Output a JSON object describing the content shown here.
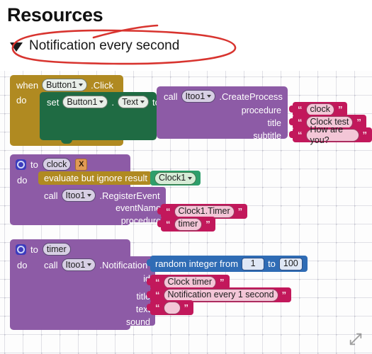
{
  "header": {
    "title": "Resources",
    "collapse_label": "Notification every second",
    "triangle_icon": "triangle-down-icon",
    "annotation_color": "#d32f2f",
    "annotation_shape": "hand-drawn-red-ellipse"
  },
  "canvas": {
    "expand_icon": "expand-diagonal-arrows-icon",
    "background": "dotted-grid"
  },
  "blocks": {
    "event_block": {
      "color": "#b08a21",
      "when_label": "when",
      "component": "Button1",
      "event": ".Click",
      "do_label": "do",
      "setter": {
        "color": "#1f6b43",
        "set_label": "set",
        "component": "Button1",
        "dot": ".",
        "property": "Text",
        "to_label": "to"
      },
      "call": {
        "color": "#8d5ba6",
        "call_label": "call",
        "component": "Itoo1",
        "method": ".CreateProcess",
        "params": [
          {
            "name": "procedure",
            "value": "clock"
          },
          {
            "name": "title",
            "value": "Clock test"
          },
          {
            "name": "subtitle",
            "value": "How are you?"
          }
        ]
      }
    },
    "clock_procedure": {
      "color": "#8d5ba6",
      "gear_icon": "gear-icon",
      "to_label": "to",
      "name": "clock",
      "close_badge": "X",
      "do_label": "do",
      "evaluate": {
        "color": "#b08a21",
        "label": "evaluate but ignore result",
        "value_color": "#2e9e6b",
        "value": "Clock1"
      },
      "call": {
        "call_label": "call",
        "component": "Itoo1",
        "method": ".RegisterEvent",
        "params": [
          {
            "name": "eventName",
            "value": "Clock1.Timer"
          },
          {
            "name": "procedure",
            "value": "timer"
          }
        ]
      }
    },
    "timer_procedure": {
      "color": "#8d5ba6",
      "gear_icon": "gear-icon",
      "to_label": "to",
      "name": "timer",
      "do_label": "do",
      "call": {
        "call_label": "call",
        "component": "Itoo1",
        "method": ".Notification",
        "id_param": {
          "name": "id",
          "block_color": "#2f6cb5",
          "label_from": "random integer from",
          "from_value": "1",
          "label_to": "to",
          "to_value": "100"
        },
        "params": [
          {
            "name": "title",
            "value": "Clock timer"
          },
          {
            "name": "text",
            "value": "Notification every 1 second"
          },
          {
            "name": "sound",
            "value": ""
          }
        ]
      }
    }
  }
}
